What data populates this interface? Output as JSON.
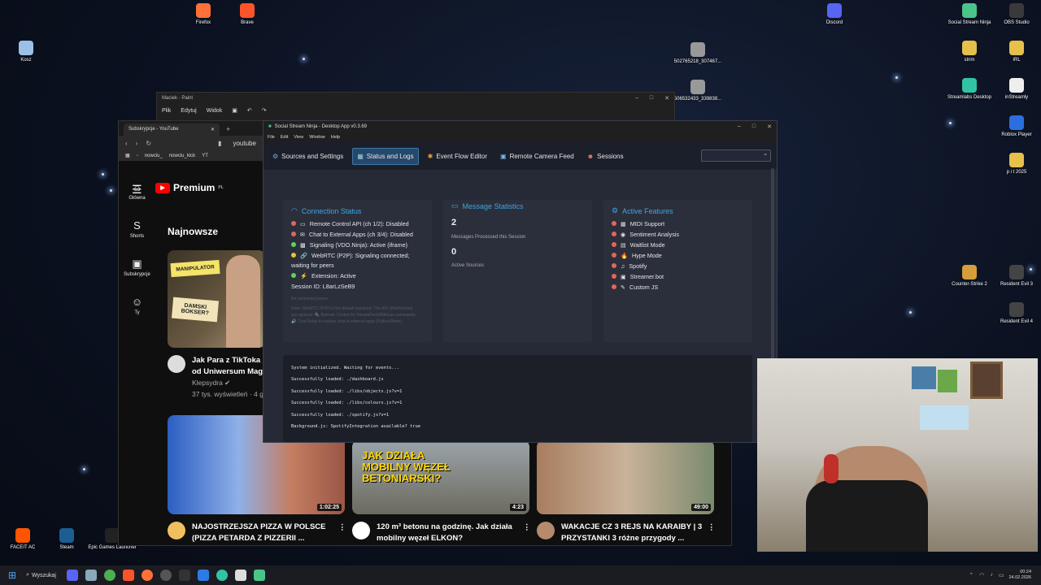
{
  "desktop": {
    "icons": [
      {
        "label": "Kosz",
        "color": "#9bc0e8"
      },
      {
        "label": "Firefox",
        "color": "#ff7139"
      },
      {
        "label": "Brave",
        "color": "#fb542b"
      },
      {
        "label": "Discord",
        "color": "#5865f2"
      },
      {
        "label": "Social Stream Ninja",
        "color": "#4bc48a"
      },
      {
        "label": "OBS Studio",
        "color": "#3a3a3a"
      },
      {
        "label": "502765218_307467...",
        "color": "#999"
      },
      {
        "label": "506532433_339838...",
        "color": "#999"
      },
      {
        "label": "strim",
        "color": "#e6c04b"
      },
      {
        "label": "IRL",
        "color": "#e6c04b"
      },
      {
        "label": "Streamlabs Desktop",
        "color": "#31c3a2"
      },
      {
        "label": "inStreamly",
        "color": "#eeeeee"
      },
      {
        "label": "Roblox Player",
        "color": "#2b6fde"
      },
      {
        "label": "p i t 2025",
        "color": "#e6c04b"
      },
      {
        "label": "Counter-Strike 2",
        "color": "#d59e3b"
      },
      {
        "label": "Resident Evil 3",
        "color": "#444"
      },
      {
        "label": "Resident Evil 4",
        "color": "#444"
      },
      {
        "label": "FACEIT AC",
        "color": "#ff5500"
      },
      {
        "label": "Steam",
        "color": "#1b5e91"
      },
      {
        "label": "Epic Games Launcher",
        "color": "#222"
      }
    ]
  },
  "paint": {
    "title": "Maciek - Paint",
    "menu": [
      "Plik",
      "Edytuj",
      "Widok"
    ]
  },
  "browser": {
    "tab_title": "Subskrypcje - YouTube",
    "addr": "youtube",
    "bookmarks": [
      "nowciu_",
      "nowciu_kick",
      "YT"
    ],
    "logo": "Premium",
    "logo_sup": "PL",
    "nav": [
      {
        "label": "Główna",
        "icon": "⌂"
      },
      {
        "label": "Shorts",
        "icon": "S"
      },
      {
        "label": "Subskrypcje",
        "icon": "▣"
      },
      {
        "label": "Ty",
        "icon": "☺"
      }
    ],
    "section": "Najnowsze",
    "v1": {
      "title1": "Jak Para z TikToka S",
      "title2": "od Uniwersum Magi",
      "channel": "Klepsydra ",
      "meta": "37 tys. wyświetleń · 4 g",
      "sign1": "MANIPULATOR",
      "sign2": "DAMSKI BOKSER?"
    },
    "v2": {
      "title1": "NAJOSTRZEJSZA PIZZA W POLSCE",
      "title2": "(PIZZA PETARDA Z PIZZERII ...",
      "duration": "1:02:25"
    },
    "v3": {
      "title1": "120 m³ betonu na godzinę. Jak działa",
      "title2": "mobilny węzeł ELKON?",
      "duration": "4:23",
      "overlay": "JAK DZIAŁA MOBILNY WĘZEŁ BETONIARSKI?"
    },
    "v4": {
      "title1": "WAKACJE CZ 3  REJS NA KARAIBY | 3",
      "title2": "PRZYSTANKI 3 różne przygody ...",
      "duration": "49:00"
    }
  },
  "ssn": {
    "title": "Social Stream Ninja - Desktop App v0.3.69",
    "menu": [
      "File",
      "Edit",
      "View",
      "Window",
      "Help"
    ],
    "tabs": [
      "Sources and Settings",
      "Status and Logs",
      "Event Flow Editor",
      "Remote Camera Feed",
      "Sessions"
    ],
    "connection": {
      "title": "Connection Status",
      "items": [
        {
          "text": "Remote Control API (ch 1/2): Disabled",
          "status": "red",
          "icon": "▭"
        },
        {
          "text": "Chat to External Apps (ch 3/4): Disabled",
          "status": "red",
          "icon": "✉"
        },
        {
          "text": "Signaling (VDO.Ninja): Active (iframe)",
          "status": "green",
          "icon": "▩"
        },
        {
          "text": "WebRTC (P2P): Signaling connected;",
          "status": "yellow",
          "icon": "🔗"
        },
        {
          "text": "waiting for peers",
          "status": "none",
          "icon": ""
        },
        {
          "text": "Extension: Active",
          "status": "green",
          "icon": "⚡"
        }
      ],
      "session": "Session ID: L8arLzSeB9",
      "no_peers": "No connected peers",
      "note": "Note: WebRTC (P2P) is the default transport. The API (WebSocket) are optional. 🔌 Remote Control for StreamDeck/Bitfocus commands. 🔊 Chat Relay to receive chat in external apps (PythonPlebs)."
    },
    "stats": {
      "title": "Message Statistics",
      "count": "2",
      "count_label": "Messages Processed this Session",
      "sources": "0",
      "sources_label": "Active Sources"
    },
    "features": {
      "title": "Active Features",
      "items": [
        {
          "text": "MIDI Support",
          "icon": "▦"
        },
        {
          "text": "Sentiment Analysis",
          "icon": "◉"
        },
        {
          "text": "Waitlist Mode",
          "icon": "▤"
        },
        {
          "text": "Hype Mode",
          "icon": "🔥"
        },
        {
          "text": "Spotify",
          "icon": "♫"
        },
        {
          "text": "Streamer.bot",
          "icon": "▣"
        },
        {
          "text": "Custom JS",
          "icon": "✎"
        }
      ]
    },
    "log": [
      "System initialized. Waiting for events...",
      "Successfully loaded: ./dashboard.js",
      "Successfully loaded: ./libs/objects.js?v=1",
      "Successfully loaded: ./libs/colours.js?v=1",
      "Successfully loaded: ./spotify.js?v=1",
      "Background.js: SpotifyIntegration available? true"
    ]
  },
  "taskbar": {
    "search": "Wyszukaj",
    "time": "00:24",
    "date": "24.02.2026"
  }
}
